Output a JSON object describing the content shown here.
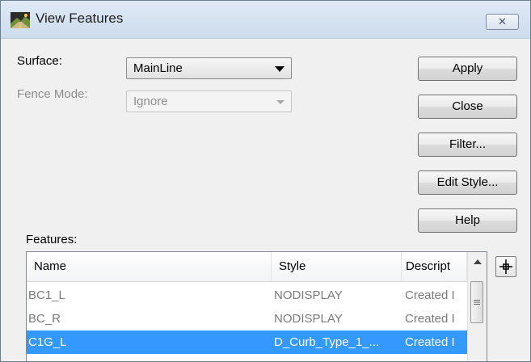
{
  "window": {
    "title": "View Features",
    "close_glyph": "✕"
  },
  "form": {
    "surface_label": "Surface:",
    "surface_value": "MainLine",
    "fence_mode_label": "Fence Mode:",
    "fence_mode_value": "Ignore",
    "features_label": "Features:"
  },
  "buttons": {
    "apply": "Apply",
    "close": "Close",
    "filter": "Filter...",
    "edit_style": "Edit Style...",
    "help": "Help"
  },
  "list": {
    "columns": [
      "Name",
      "Style",
      "Descript"
    ],
    "rows": [
      {
        "name": "BC1_L",
        "style": "NODISPLAY",
        "description": "Created I"
      },
      {
        "name": "BC_R",
        "style": "NODISPLAY",
        "description": "Created I"
      },
      {
        "name": "C1G_L",
        "style": "D_Curb_Type_1_...",
        "description": "Created I",
        "selected": true
      }
    ]
  },
  "colors": {
    "selection": "#3399ff",
    "title_bar": "#dfe9f5"
  }
}
